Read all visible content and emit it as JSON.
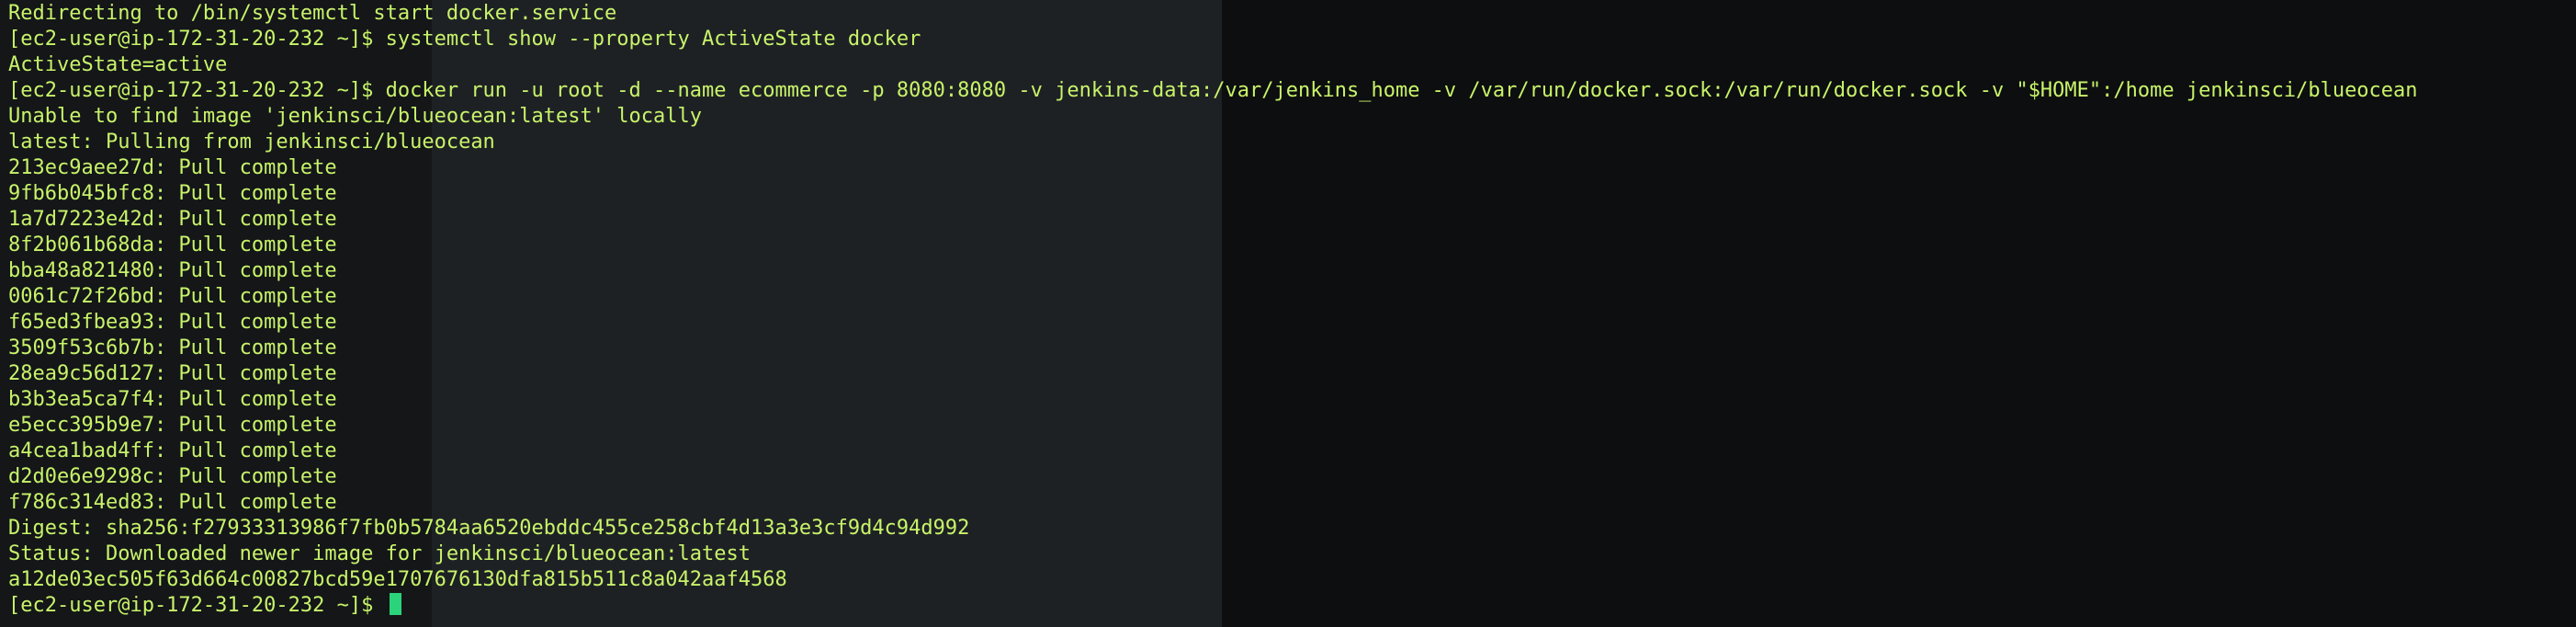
{
  "terminal": {
    "colors": {
      "text": "#c8f36a",
      "cursor": "#2bd37a",
      "background": "#121416"
    },
    "lines": [
      "Redirecting to /bin/systemctl start docker.service",
      "[ec2-user@ip-172-31-20-232 ~]$ systemctl show --property ActiveState docker",
      "ActiveState=active",
      "[ec2-user@ip-172-31-20-232 ~]$ docker run -u root -d --name ecommerce -p 8080:8080 -v jenkins-data:/var/jenkins_home -v /var/run/docker.sock:/var/run/docker.sock -v \"$HOME\":/home jenkinsci/blueocean",
      "Unable to find image 'jenkinsci/blueocean:latest' locally",
      "latest: Pulling from jenkinsci/blueocean",
      "213ec9aee27d: Pull complete",
      "9fb6b045bfc8: Pull complete",
      "1a7d7223e42d: Pull complete",
      "8f2b061b68da: Pull complete",
      "bba48a821480: Pull complete",
      "0061c72f26bd: Pull complete",
      "f65ed3fbea93: Pull complete",
      "3509f53c6b7b: Pull complete",
      "28ea9c56d127: Pull complete",
      "b3b3ea5ca7f4: Pull complete",
      "e5ecc395b9e7: Pull complete",
      "a4cea1bad4ff: Pull complete",
      "d2d0e6e9298c: Pull complete",
      "f786c314ed83: Pull complete",
      "Digest: sha256:f27933313986f7fb0b5784aa6520ebddc455ce258cbf4d13a3e3cf9d4c94d992",
      "Status: Downloaded newer image for jenkinsci/blueocean:latest",
      "a12de03ec505f63d664c00827bcd59e1707676130dfa815b511c8a042aaf4568"
    ],
    "prompt": "[ec2-user@ip-172-31-20-232 ~]$ "
  }
}
